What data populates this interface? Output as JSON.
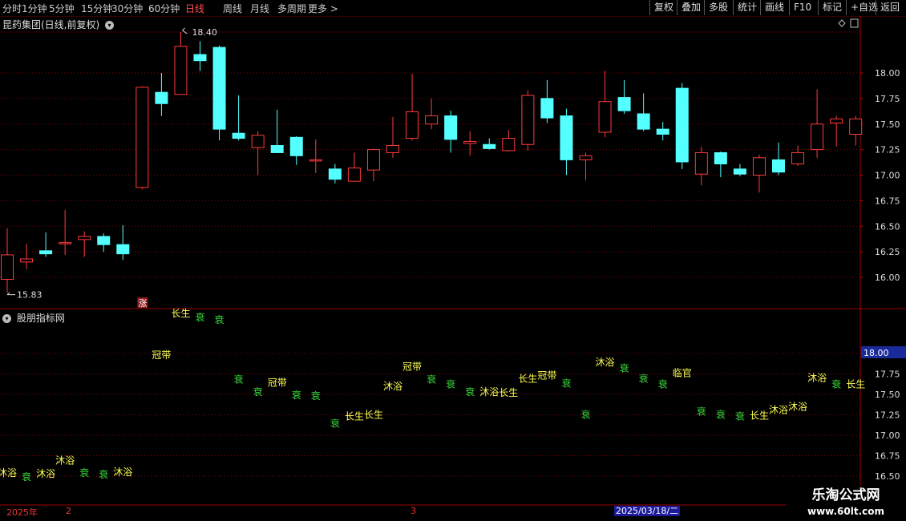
{
  "toolbar": {
    "periods": [
      "分时",
      "1分钟",
      "5分钟",
      "15分钟",
      "30分钟",
      "60分钟",
      "日线",
      "周线",
      "月线",
      "多周期",
      "更多 >"
    ],
    "active_period": "日线",
    "actions": [
      "复权",
      "叠加",
      "多股",
      "统计",
      "画线",
      "F10",
      "标记",
      "+自选",
      "返回"
    ]
  },
  "main_title": "昆药集团(日线,前复权)",
  "indicator_title": "股朋指标网",
  "zhang_badge": "涨",
  "highlight_price": "18.00",
  "date_cursor": "2025/03/18/二",
  "year_label": "2025年",
  "month_labels": [
    "2",
    "3"
  ],
  "watermark": {
    "title": "乐淘公式网",
    "url": "www.60lt.com"
  },
  "colors": {
    "up": "#ff3b3b",
    "down": "#54ffff",
    "yellow_text": "#ffff54",
    "green_text": "#37d23b",
    "grid": "#8b0000"
  },
  "chart_data": {
    "type": "candlestick",
    "price_axis_ticks": [
      "18.00",
      "17.75",
      "17.50",
      "17.25",
      "17.00",
      "16.75",
      "16.50",
      "16.25",
      "16.00"
    ],
    "indicator_axis_ticks": [
      "18.00",
      "17.75",
      "17.50",
      "17.25",
      "17.00",
      "16.75",
      "16.50"
    ],
    "max_label": "18.40",
    "min_label": "15.83",
    "candles": [
      {
        "o": 15.98,
        "h": 16.48,
        "l": 15.85,
        "c": 16.22
      },
      {
        "o": 16.15,
        "h": 16.33,
        "l": 16.08,
        "c": 16.18
      },
      {
        "o": 16.26,
        "h": 16.44,
        "l": 16.2,
        "c": 16.23
      },
      {
        "o": 16.33,
        "h": 16.66,
        "l": 16.22,
        "c": 16.34
      },
      {
        "o": 16.37,
        "h": 16.45,
        "l": 16.2,
        "c": 16.4
      },
      {
        "o": 16.4,
        "h": 16.43,
        "l": 16.25,
        "c": 16.32
      },
      {
        "o": 16.32,
        "h": 16.51,
        "l": 16.17,
        "c": 16.23
      },
      {
        "o": 16.88,
        "h": 17.87,
        "l": 16.86,
        "c": 17.86
      },
      {
        "o": 17.81,
        "h": 18.0,
        "l": 17.58,
        "c": 17.7
      },
      {
        "o": 17.79,
        "h": 18.4,
        "l": 17.79,
        "c": 18.26
      },
      {
        "o": 18.18,
        "h": 18.31,
        "l": 18.02,
        "c": 18.12
      },
      {
        "o": 18.25,
        "h": 18.27,
        "l": 17.34,
        "c": 17.45
      },
      {
        "o": 17.41,
        "h": 17.78,
        "l": 17.34,
        "c": 17.36
      },
      {
        "o": 17.27,
        "h": 17.43,
        "l": 17.0,
        "c": 17.39
      },
      {
        "o": 17.29,
        "h": 17.64,
        "l": 17.22,
        "c": 17.22
      },
      {
        "o": 17.37,
        "h": 17.38,
        "l": 17.1,
        "c": 17.19
      },
      {
        "o": 17.15,
        "h": 17.35,
        "l": 17.02,
        "c": 17.15
      },
      {
        "o": 17.06,
        "h": 17.11,
        "l": 16.92,
        "c": 16.96
      },
      {
        "o": 16.94,
        "h": 17.22,
        "l": 16.94,
        "c": 17.07
      },
      {
        "o": 17.05,
        "h": 17.26,
        "l": 16.94,
        "c": 17.25
      },
      {
        "o": 17.22,
        "h": 17.57,
        "l": 17.17,
        "c": 17.29
      },
      {
        "o": 17.36,
        "h": 17.99,
        "l": 17.34,
        "c": 17.62
      },
      {
        "o": 17.5,
        "h": 17.75,
        "l": 17.45,
        "c": 17.58
      },
      {
        "o": 17.58,
        "h": 17.63,
        "l": 17.22,
        "c": 17.35
      },
      {
        "o": 17.31,
        "h": 17.43,
        "l": 17.19,
        "c": 17.33
      },
      {
        "o": 17.3,
        "h": 17.36,
        "l": 17.25,
        "c": 17.26
      },
      {
        "o": 17.24,
        "h": 17.44,
        "l": 17.23,
        "c": 17.36
      },
      {
        "o": 17.3,
        "h": 17.83,
        "l": 17.24,
        "c": 17.78
      },
      {
        "o": 17.75,
        "h": 17.93,
        "l": 17.51,
        "c": 17.56
      },
      {
        "o": 17.58,
        "h": 17.65,
        "l": 17.0,
        "c": 17.15
      },
      {
        "o": 17.15,
        "h": 17.22,
        "l": 16.95,
        "c": 17.19
      },
      {
        "o": 17.42,
        "h": 18.02,
        "l": 17.37,
        "c": 17.72
      },
      {
        "o": 17.76,
        "h": 17.93,
        "l": 17.6,
        "c": 17.63
      },
      {
        "o": 17.6,
        "h": 17.8,
        "l": 17.43,
        "c": 17.45
      },
      {
        "o": 17.45,
        "h": 17.52,
        "l": 17.34,
        "c": 17.4
      },
      {
        "o": 17.85,
        "h": 17.9,
        "l": 17.06,
        "c": 17.13
      },
      {
        "o": 17.01,
        "h": 17.28,
        "l": 16.9,
        "c": 17.22
      },
      {
        "o": 17.22,
        "h": 17.23,
        "l": 16.98,
        "c": 17.11
      },
      {
        "o": 17.06,
        "h": 17.11,
        "l": 16.99,
        "c": 17.01
      },
      {
        "o": 17.0,
        "h": 17.2,
        "l": 16.83,
        "c": 17.17
      },
      {
        "o": 17.15,
        "h": 17.32,
        "l": 17.0,
        "c": 17.03
      },
      {
        "o": 17.11,
        "h": 17.29,
        "l": 17.09,
        "c": 17.22
      },
      {
        "o": 17.25,
        "h": 17.84,
        "l": 17.17,
        "c": 17.5
      },
      {
        "o": 17.51,
        "h": 17.58,
        "l": 17.28,
        "c": 17.55
      },
      {
        "o": 17.4,
        "h": 17.58,
        "l": 17.29,
        "c": 17.55
      }
    ],
    "indicator_labels": [
      {
        "i": 0,
        "text": "沐浴",
        "v": 16.55,
        "color": "yellow"
      },
      {
        "i": 1,
        "text": "衰",
        "v": 16.5,
        "color": "green"
      },
      {
        "i": 2,
        "text": "沐浴",
        "v": 16.54,
        "color": "yellow"
      },
      {
        "i": 3,
        "text": "沐浴",
        "v": 16.7,
        "color": "yellow"
      },
      {
        "i": 4,
        "text": "衰",
        "v": 16.55,
        "color": "green"
      },
      {
        "i": 5,
        "text": "衰",
        "v": 16.53,
        "color": "green"
      },
      {
        "i": 6,
        "text": "沐浴",
        "v": 16.56,
        "color": "yellow"
      },
      {
        "i": 8,
        "text": "冠带",
        "v": 17.99,
        "color": "yellow"
      },
      {
        "i": 9,
        "text": "长生",
        "v": 18.5,
        "color": "yellow"
      },
      {
        "i": 10,
        "text": "衰",
        "v": 18.45,
        "color": "green"
      },
      {
        "i": 11,
        "text": "衰",
        "v": 18.42,
        "color": "green"
      },
      {
        "i": 12,
        "text": "衰",
        "v": 17.69,
        "color": "green"
      },
      {
        "i": 13,
        "text": "衰",
        "v": 17.54,
        "color": "green"
      },
      {
        "i": 14,
        "text": "冠带",
        "v": 17.65,
        "color": "yellow"
      },
      {
        "i": 15,
        "text": "衰",
        "v": 17.5,
        "color": "green"
      },
      {
        "i": 16,
        "text": "衰",
        "v": 17.49,
        "color": "green"
      },
      {
        "i": 17,
        "text": "衰",
        "v": 17.15,
        "color": "green"
      },
      {
        "i": 18,
        "text": "长生",
        "v": 17.24,
        "color": "yellow"
      },
      {
        "i": 19,
        "text": "长生",
        "v": 17.26,
        "color": "yellow"
      },
      {
        "i": 20,
        "text": "沐浴",
        "v": 17.61,
        "color": "yellow"
      },
      {
        "i": 21,
        "text": "冠带",
        "v": 17.85,
        "color": "yellow"
      },
      {
        "i": 22,
        "text": "衰",
        "v": 17.69,
        "color": "green"
      },
      {
        "i": 23,
        "text": "衰",
        "v": 17.63,
        "color": "green"
      },
      {
        "i": 24,
        "text": "衰",
        "v": 17.54,
        "color": "green"
      },
      {
        "i": 25,
        "text": "沐浴",
        "v": 17.54,
        "color": "yellow"
      },
      {
        "i": 26,
        "text": "长生",
        "v": 17.53,
        "color": "yellow"
      },
      {
        "i": 27,
        "text": "长生",
        "v": 17.7,
        "color": "yellow"
      },
      {
        "i": 28,
        "text": "冠带",
        "v": 17.74,
        "color": "yellow"
      },
      {
        "i": 29,
        "text": "衰",
        "v": 17.64,
        "color": "green"
      },
      {
        "i": 30,
        "text": "衰",
        "v": 17.26,
        "color": "green"
      },
      {
        "i": 31,
        "text": "沐浴",
        "v": 17.9,
        "color": "yellow"
      },
      {
        "i": 32,
        "text": "衰",
        "v": 17.83,
        "color": "green"
      },
      {
        "i": 33,
        "text": "衰",
        "v": 17.7,
        "color": "green"
      },
      {
        "i": 34,
        "text": "衰",
        "v": 17.63,
        "color": "green"
      },
      {
        "i": 35,
        "text": "临官",
        "v": 17.77,
        "color": "yellow"
      },
      {
        "i": 36,
        "text": "衰",
        "v": 17.3,
        "color": "green"
      },
      {
        "i": 37,
        "text": "衰",
        "v": 17.26,
        "color": "green"
      },
      {
        "i": 38,
        "text": "衰",
        "v": 17.24,
        "color": "green"
      },
      {
        "i": 39,
        "text": "长生",
        "v": 17.25,
        "color": "yellow"
      },
      {
        "i": 40,
        "text": "沐浴",
        "v": 17.32,
        "color": "yellow"
      },
      {
        "i": 41,
        "text": "沐浴",
        "v": 17.36,
        "color": "yellow"
      },
      {
        "i": 42,
        "text": "沐浴",
        "v": 17.71,
        "color": "yellow"
      },
      {
        "i": 43,
        "text": "衰",
        "v": 17.63,
        "color": "green"
      },
      {
        "i": 44,
        "text": "长生",
        "v": 17.63,
        "color": "yellow"
      }
    ]
  }
}
